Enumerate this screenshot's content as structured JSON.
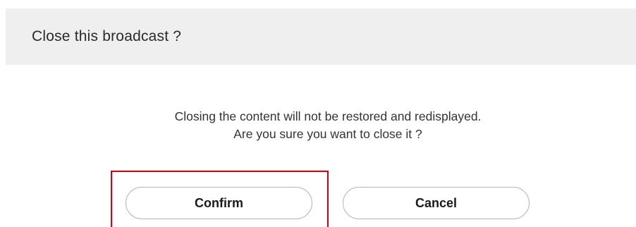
{
  "dialog": {
    "title": "Close this broadcast ?",
    "message_line1": "Closing the content will not be restored and redisplayed.",
    "message_line2": "Are you sure you want to close it ?",
    "confirm_label": "Confirm",
    "cancel_label": "Cancel"
  },
  "colors": {
    "header_background": "#efefef",
    "highlight_border": "#d8000c",
    "button_border": "#b5b5b5"
  }
}
